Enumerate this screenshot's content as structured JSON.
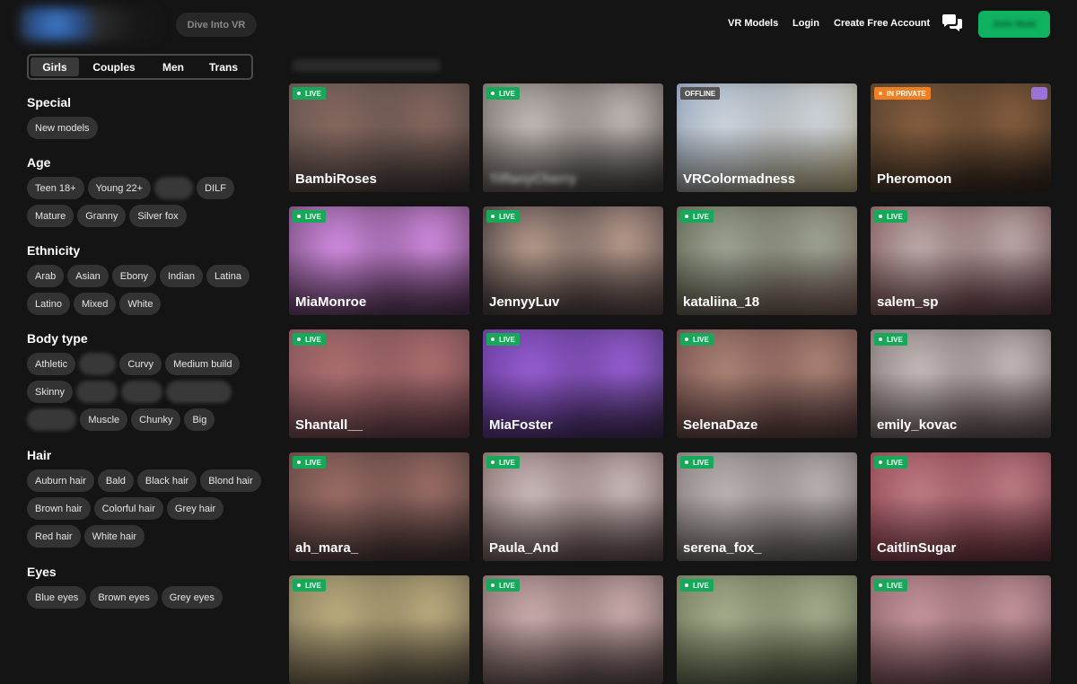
{
  "header": {
    "dive_label": "Dive Into VR",
    "nav": [
      "VR Models",
      "Login",
      "Create Free Account"
    ],
    "chat_icon": "chat-bubbles-icon",
    "accent": "#0fb25f",
    "cta_label": "Join Now"
  },
  "tabs": [
    {
      "label": "Girls",
      "active": true
    },
    {
      "label": "Couples",
      "active": false
    },
    {
      "label": "Men",
      "active": false
    },
    {
      "label": "Trans",
      "active": false
    }
  ],
  "filters": [
    {
      "title": "Special",
      "chips": [
        {
          "label": "New models"
        }
      ]
    },
    {
      "title": "Age",
      "chips": [
        {
          "label": "Teen 18+"
        },
        {
          "label": "Young 22+"
        },
        {
          "label": "MILF",
          "blurred": true
        },
        {
          "label": "DILF"
        },
        {
          "label": "Mature"
        },
        {
          "label": "Granny"
        },
        {
          "label": "Silver fox"
        }
      ]
    },
    {
      "title": "Ethnicity",
      "chips": [
        {
          "label": "Arab"
        },
        {
          "label": "Asian"
        },
        {
          "label": "Ebony"
        },
        {
          "label": "Indian"
        },
        {
          "label": "Latina"
        },
        {
          "label": "Latino"
        },
        {
          "label": "Mixed"
        },
        {
          "label": "White"
        }
      ]
    },
    {
      "title": "Body type",
      "chips": [
        {
          "label": "Athletic"
        },
        {
          "label": "Bear",
          "blurred": true
        },
        {
          "label": "Curvy"
        },
        {
          "label": "Medium build"
        },
        {
          "label": "Skinny"
        },
        {
          "label": "Petite",
          "blurred": true
        },
        {
          "label": "Small",
          "blurred": true
        },
        {
          "label": "Big breasts",
          "blurred": true
        },
        {
          "label": "Big butt",
          "blurred": true
        },
        {
          "label": "Muscle"
        },
        {
          "label": "Chunky"
        },
        {
          "label": "Big"
        }
      ]
    },
    {
      "title": "Hair",
      "chips": [
        {
          "label": "Auburn hair"
        },
        {
          "label": "Bald"
        },
        {
          "label": "Black hair"
        },
        {
          "label": "Blond hair"
        },
        {
          "label": "Brown hair"
        },
        {
          "label": "Colorful hair"
        },
        {
          "label": "Grey hair"
        },
        {
          "label": "Red hair"
        },
        {
          "label": "White hair"
        }
      ]
    },
    {
      "title": "Eyes",
      "chips": [
        {
          "label": "Blue eyes"
        },
        {
          "label": "Brown eyes"
        },
        {
          "label": "Grey eyes"
        }
      ]
    }
  ],
  "models": [
    {
      "name": "BambiRoses",
      "status": "LIVE",
      "colors": [
        "#6a5a55",
        "#8a6a60",
        "#3a3232"
      ]
    },
    {
      "name": "TiffanyCherry",
      "status": "LIVE",
      "name_blurred": true,
      "colors": [
        "#7d7570",
        "#c8c0bc",
        "#3e3a38"
      ]
    },
    {
      "name": "VRColormadness",
      "status": "OFFLINE",
      "colors": [
        "#8aa2c8",
        "#cfd6e0",
        "#b8a470"
      ]
    },
    {
      "name": "Pheromoon",
      "status": "IN PRIVATE",
      "vr": true,
      "colors": [
        "#5a4530",
        "#8a6040",
        "#2a2018"
      ]
    },
    {
      "name": "MiaMonroe",
      "status": "LIVE",
      "colors": [
        "#7a5080",
        "#d890e8",
        "#503050"
      ]
    },
    {
      "name": "JennyyLuv",
      "status": "LIVE",
      "colors": [
        "#3a3438",
        "#bea090",
        "#5a4a48"
      ]
    },
    {
      "name": "kataliina_18",
      "status": "LIVE",
      "colors": [
        "#5a6a50",
        "#a0a898",
        "#7a5a58"
      ]
    },
    {
      "name": "salem_sp",
      "status": "LIVE",
      "colors": [
        "#8a6060",
        "#c0b0b0",
        "#5a3a40"
      ]
    },
    {
      "name": "Shantall__",
      "status": "LIVE",
      "colors": [
        "#8a5a60",
        "#b07070",
        "#5a3840"
      ]
    },
    {
      "name": "MiaFoster",
      "status": "LIVE",
      "colors": [
        "#6a3aa0",
        "#9a60d8",
        "#3a2a50"
      ]
    },
    {
      "name": "SelenaDaze",
      "status": "LIVE",
      "colors": [
        "#7a5050",
        "#b08878",
        "#503838"
      ]
    },
    {
      "name": "emily_kovac",
      "status": "LIVE",
      "colors": [
        "#8a7a7a",
        "#c8c0c0",
        "#5a4a4a"
      ]
    },
    {
      "name": "ah_mara_",
      "status": "LIVE",
      "colors": [
        "#6a4a48",
        "#a07068",
        "#3a2e2e"
      ]
    },
    {
      "name": "Paula_And",
      "status": "LIVE",
      "colors": [
        "#8a7070",
        "#d0c0c0",
        "#5a4848"
      ]
    },
    {
      "name": "serena_fox_",
      "status": "LIVE",
      "colors": [
        "#8a8080",
        "#c0b8b8",
        "#605858"
      ]
    },
    {
      "name": "CaitlinSugar",
      "status": "LIVE",
      "colors": [
        "#a04a58",
        "#c08088",
        "#603038"
      ]
    },
    {
      "name": "",
      "status": "LIVE",
      "colors": [
        "#8a8060",
        "#c0b080",
        "#5a5040"
      ]
    },
    {
      "name": "",
      "status": "LIVE",
      "colors": [
        "#8a7070",
        "#d0b0b0",
        "#5a4848"
      ]
    },
    {
      "name": "",
      "status": "LIVE",
      "colors": [
        "#7a8060",
        "#a8b090",
        "#505840"
      ]
    },
    {
      "name": "",
      "status": "LIVE",
      "colors": [
        "#9a6a70",
        "#c898a0",
        "#604048"
      ]
    }
  ]
}
